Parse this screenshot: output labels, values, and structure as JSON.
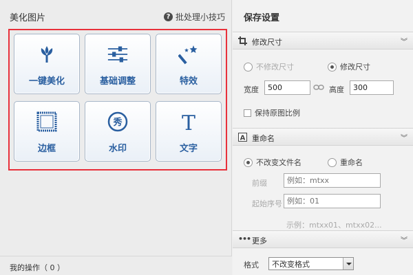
{
  "left": {
    "title": "美化图片",
    "tips_label": "批处理小技巧",
    "tools": [
      {
        "label": "一键美化",
        "icon": "tulip-icon"
      },
      {
        "label": "基础调整",
        "icon": "sliders-icon"
      },
      {
        "label": "特效",
        "icon": "magic-wand-icon"
      },
      {
        "label": "边框",
        "icon": "frame-icon"
      },
      {
        "label": "水印",
        "icon": "watermark-icon",
        "badge": "秀"
      },
      {
        "label": "文字",
        "icon": "text-icon",
        "glyph": "T"
      }
    ],
    "footer": "我的操作（ 0 ）"
  },
  "right": {
    "title": "保存设置",
    "resize": {
      "section_title": "修改尺寸",
      "no_resize_label": "不修改尺寸",
      "resize_label": "修改尺寸",
      "selected": "resize",
      "width_label": "宽度",
      "width_value": "500",
      "height_label": "高度",
      "height_value": "300",
      "keep_ratio_label": "保持原图比例",
      "keep_ratio_checked": false
    },
    "rename": {
      "section_title": "重命名",
      "keep_name_label": "不改变文件名",
      "rename_label": "重命名",
      "selected": "keep_name",
      "prefix_label": "前缀",
      "prefix_placeholder": "例如：mtxx",
      "start_label": "起始序号",
      "start_placeholder": "例如：01",
      "example": "示例：mtxx01、mtxx02..."
    },
    "more": {
      "section_title": "更多",
      "format_label": "格式",
      "format_value": "不改变格式"
    }
  },
  "colors": {
    "accent_blue": "#2a5fa0",
    "highlight_red": "#e8303a"
  }
}
